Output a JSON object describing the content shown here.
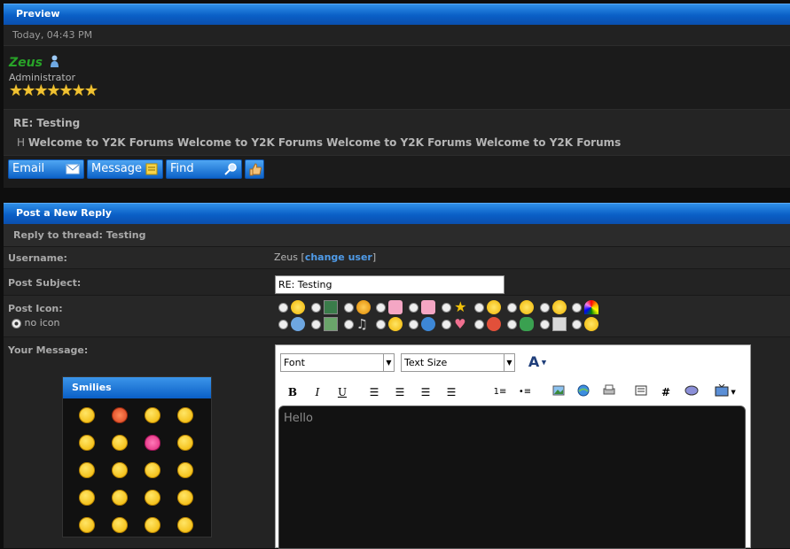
{
  "preview": {
    "title": "Preview",
    "date": "Today, 04:43 PM",
    "username": "Zeus",
    "role": "Administrator",
    "stars": "★★★★★★★",
    "subject": "RE: Testing",
    "message_prefix": "H",
    "message": "Welcome to Y2K Forums Welcome to Y2K Forums Welcome to Y2K Forums Welcome to Y2K Forums",
    "buttons": {
      "email": "Email",
      "message": "Message",
      "find": "Find"
    }
  },
  "reply": {
    "title": "Post a New Reply",
    "thread_label": "Reply to thread: Testing",
    "username_label": "Username:",
    "username_value": "Zeus",
    "change_user_open": "[",
    "change_user": "change user",
    "change_user_close": "]",
    "subject_label": "Post Subject:",
    "subject_value": "RE: Testing",
    "icon_label": "Post Icon:",
    "no_icon": "no icon",
    "message_label": "Your Message:",
    "smilies_title": "Smilies",
    "editor": {
      "font": "Font",
      "text_size": "Text Size",
      "bold": "B",
      "italic": "I",
      "underline": "U",
      "hash": "#",
      "content": "Hello"
    }
  }
}
